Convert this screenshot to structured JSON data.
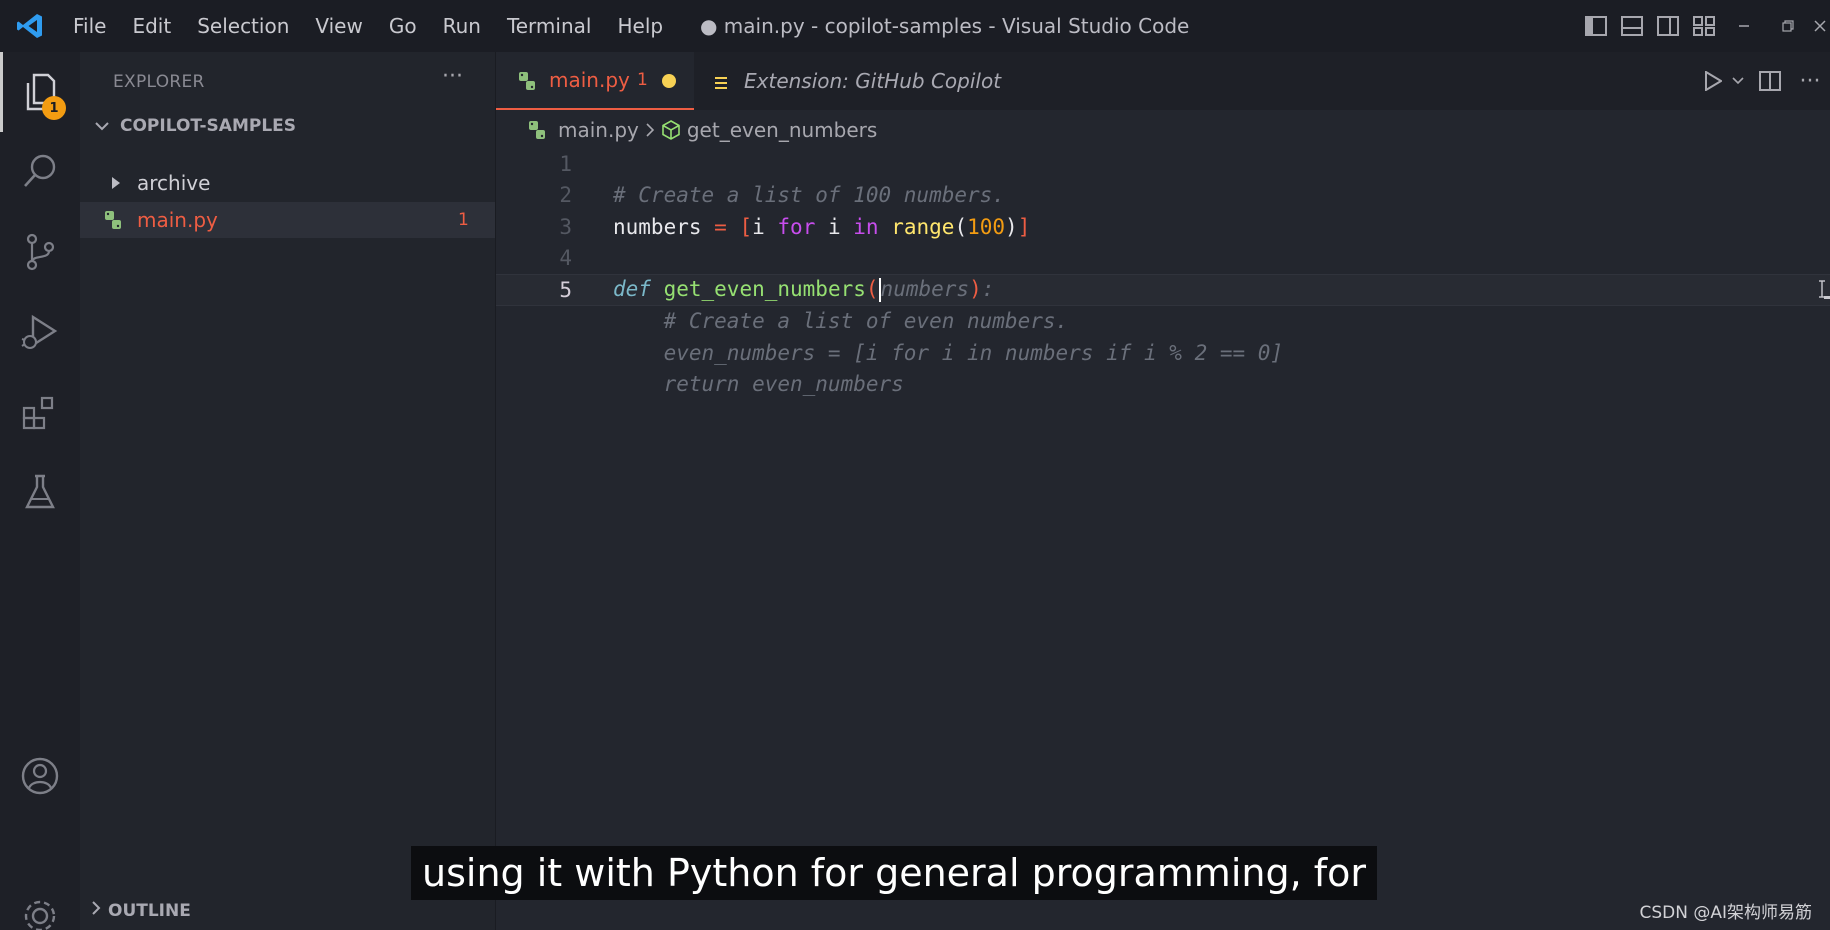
{
  "menu": [
    "File",
    "Edit",
    "Selection",
    "View",
    "Go",
    "Run",
    "Terminal",
    "Help"
  ],
  "window_title": "● main.py - copilot-samples - Visual Studio Code",
  "activity": {
    "explorer_badge": "1"
  },
  "sidebar": {
    "header": "EXPLORER",
    "more": "···",
    "section": "COPILOT-SAMPLES",
    "items": [
      {
        "label": "archive",
        "type": "folder"
      },
      {
        "label": "main.py",
        "type": "file",
        "badge": "1"
      }
    ],
    "outline": "OUTLINE"
  },
  "tabs": [
    {
      "label": "main.py",
      "problems": "1",
      "dirty": true
    },
    {
      "label": "Extension: GitHub Copilot"
    }
  ],
  "breadcrumb": {
    "file": "main.py",
    "symbol": "get_even_numbers"
  },
  "code": {
    "line_numbers": [
      "1",
      "2",
      "3",
      "4",
      "5"
    ],
    "line2": "# Create a list of 100 numbers.",
    "line3": {
      "var": "numbers",
      "eq": " = ",
      "lb": "[",
      "a": "i ",
      "for": "for",
      "b": " i ",
      "in": "in",
      "c": " ",
      "range": "range",
      "lp": "(",
      "num": "100",
      "rp": ")",
      "rb": "]"
    },
    "line5": {
      "def": "def",
      "sp": " ",
      "name": "get_even_numbers",
      "lp": "(",
      "ghost_param": "numbers",
      "rp": ")",
      "ghost_colon": ":"
    },
    "suggestion": [
      "    # Create a list of even numbers.",
      "    even_numbers = [i for i in numbers if i % 2 == 0]",
      "    return even_numbers"
    ]
  },
  "caption": "using it with Python for general programming, for",
  "watermark": "CSDN @AI架构师易筋",
  "colors": {
    "accent": "#ee5d43",
    "dirty_dot": "#f7d154",
    "badge": "#f39c12",
    "python_icon": "#8ec07c"
  }
}
